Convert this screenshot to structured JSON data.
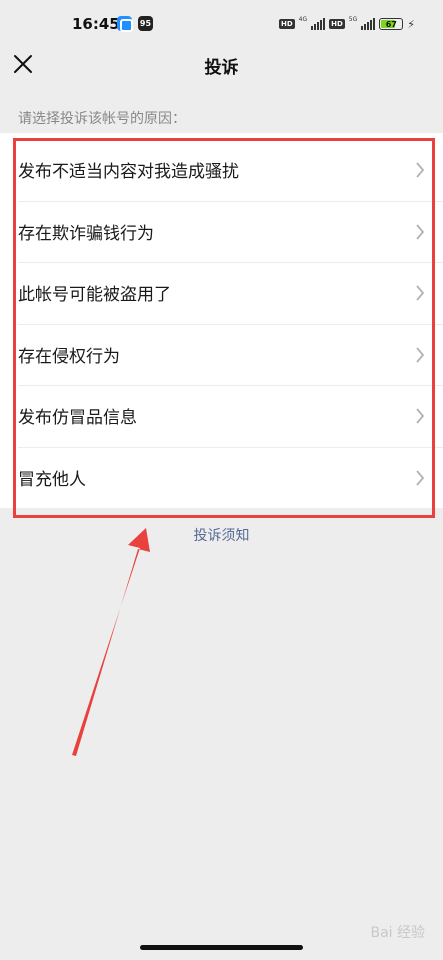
{
  "status_bar": {
    "time": "16:45",
    "battery_level": "67",
    "network_1": "4G",
    "network_2": "5G",
    "hd_label": "HD",
    "app_badge_text": "95"
  },
  "nav": {
    "title": "投诉",
    "close_icon": "close-icon"
  },
  "hint": "请选择投诉该帐号的原因：",
  "reasons": [
    {
      "label": "发布不适当内容对我造成骚扰"
    },
    {
      "label": "存在欺诈骗钱行为"
    },
    {
      "label": "此帐号可能被盗用了"
    },
    {
      "label": "存在侵权行为"
    },
    {
      "label": "发布仿冒品信息"
    },
    {
      "label": "冒充他人"
    }
  ],
  "notice_link": "投诉须知",
  "watermark": "Bai 经验",
  "colors": {
    "highlight": "#e8413e",
    "link": "#576b95",
    "background": "#ededed"
  }
}
